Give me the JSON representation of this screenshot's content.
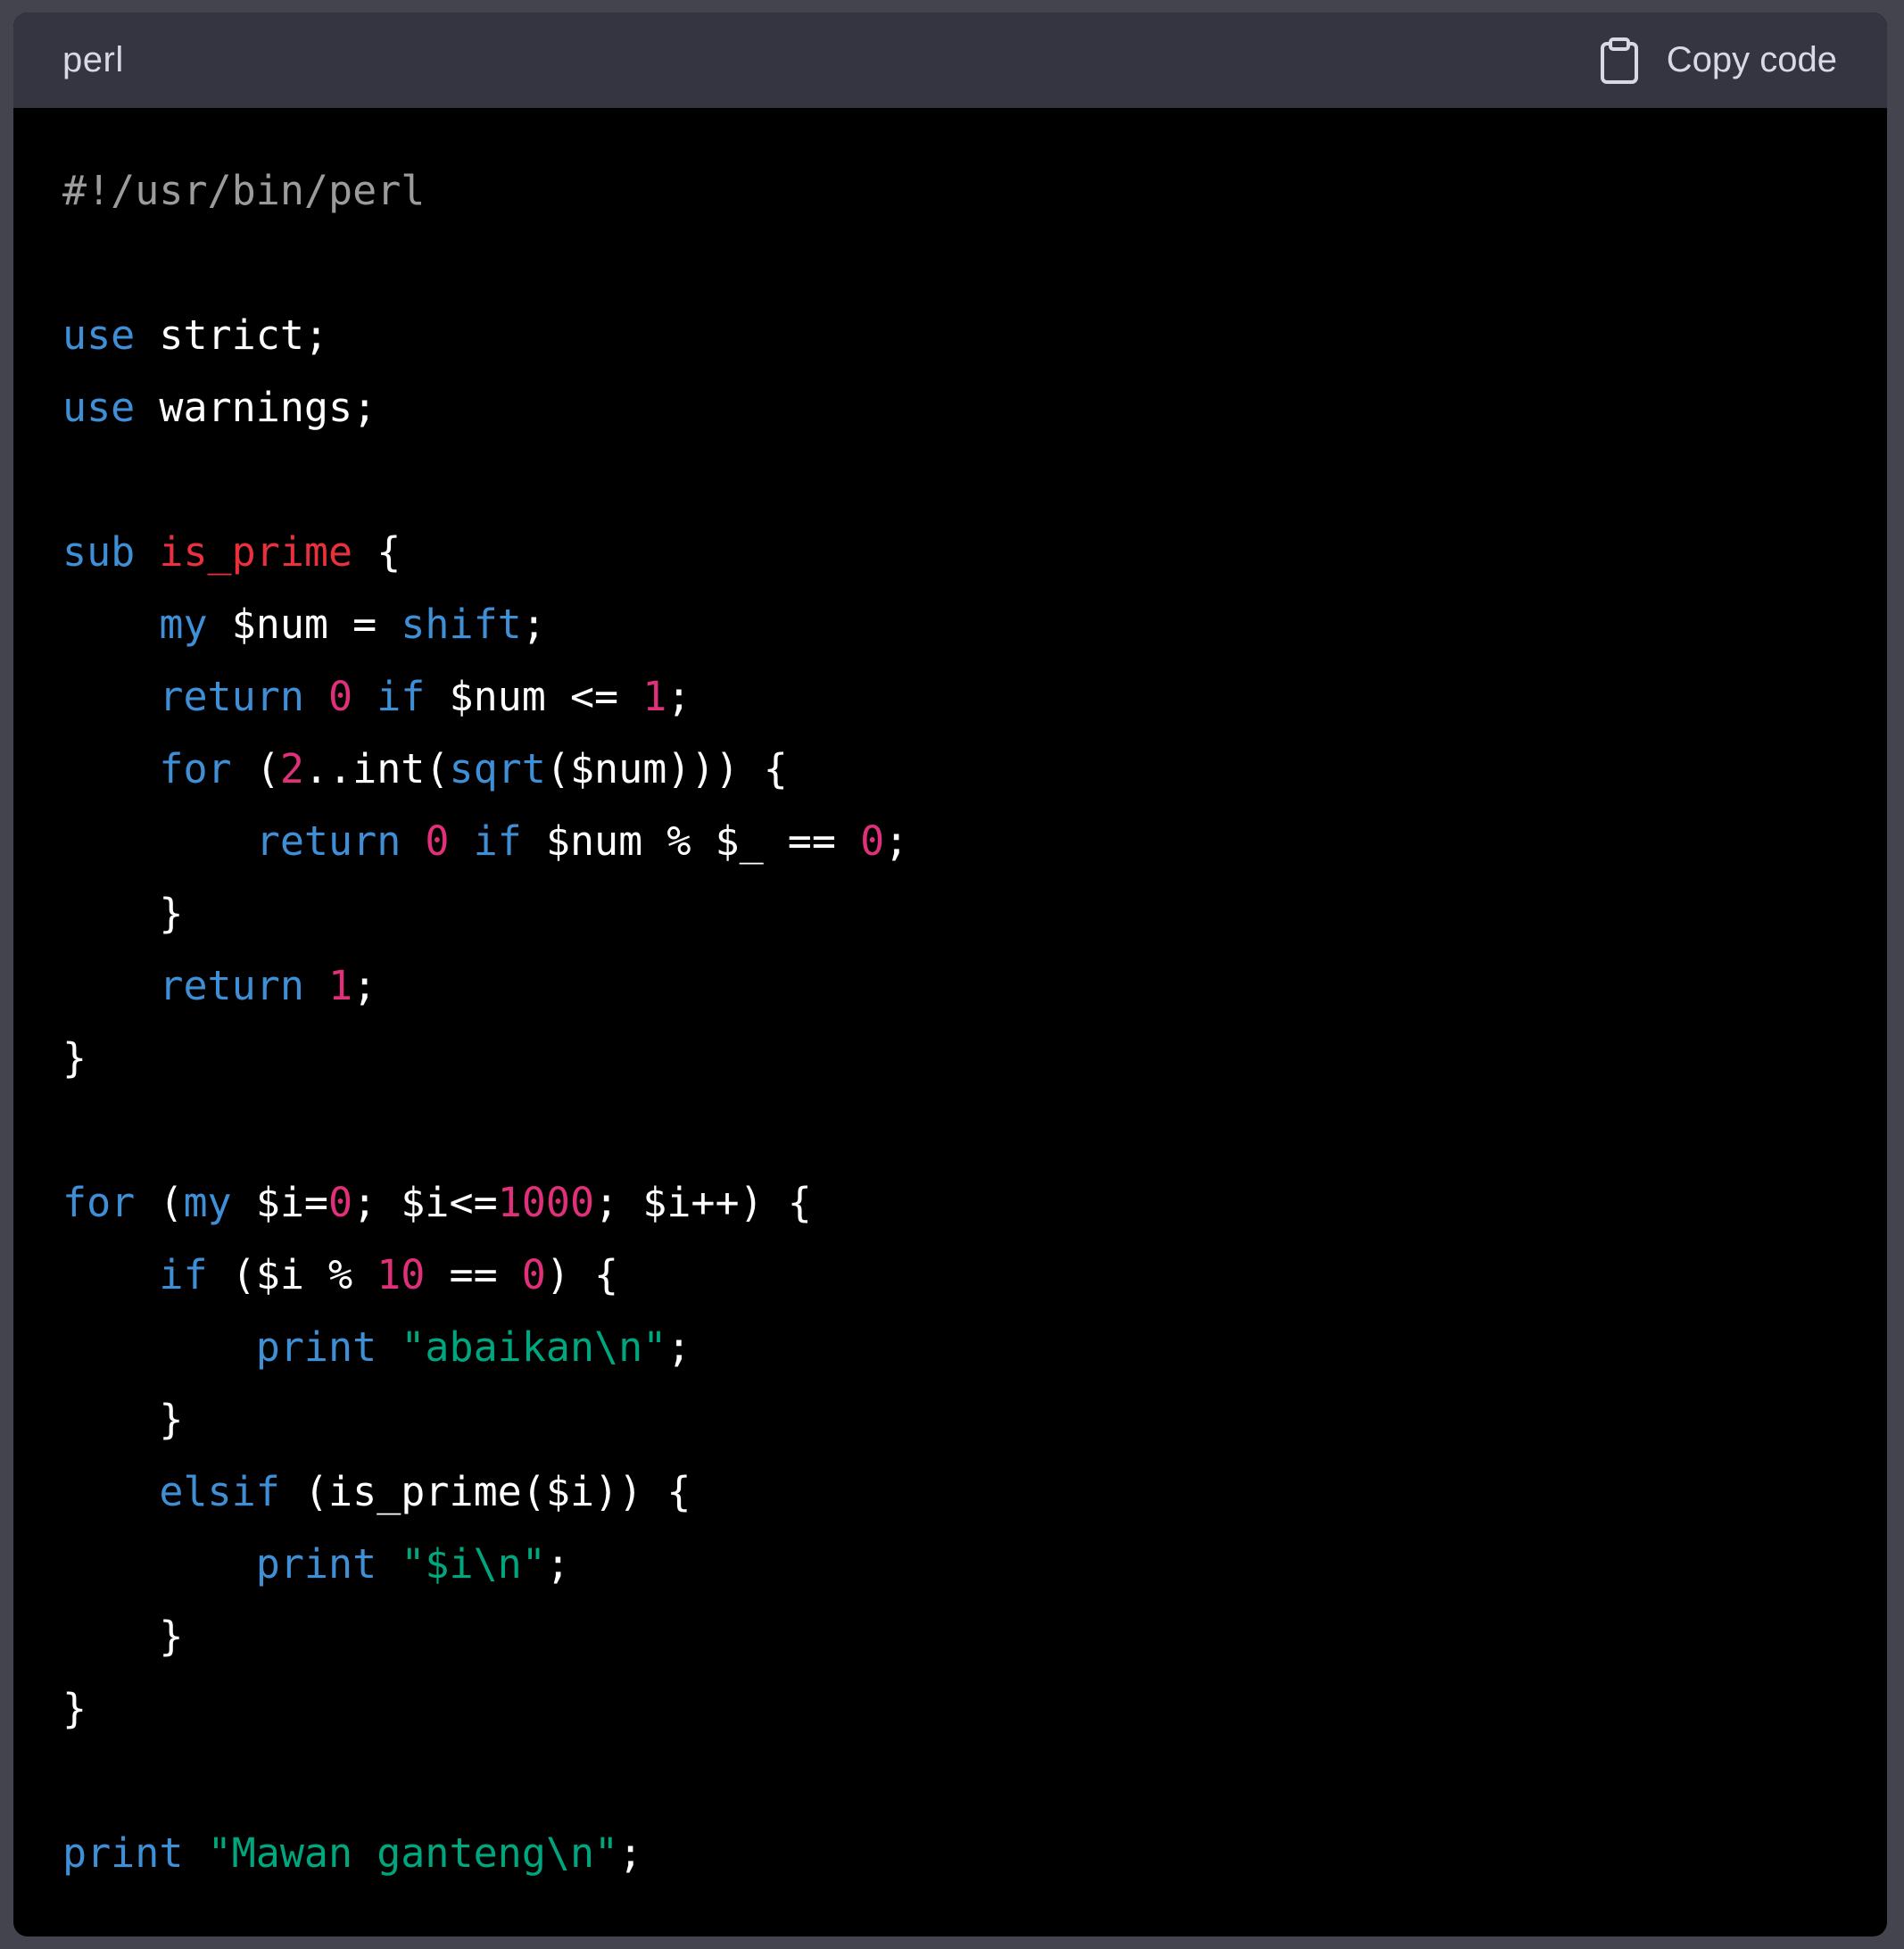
{
  "header": {
    "language": "perl",
    "copy_label": "Copy code",
    "copy_icon": "clipboard-icon"
  },
  "colors": {
    "header_bg": "#343541",
    "code_bg": "#000000",
    "keyword": "#3f8fd6",
    "function_name": "#e9313d",
    "number": "#df3079",
    "string": "#00a67d",
    "comment": "#9b9b9b",
    "plain": "#ffffff"
  },
  "code_lines": [
    [
      {
        "t": "comment",
        "v": "#!/usr/bin/perl"
      }
    ],
    [],
    [
      {
        "t": "keyword",
        "v": "use"
      },
      {
        "t": "plain",
        "v": " strict;"
      }
    ],
    [
      {
        "t": "keyword",
        "v": "use"
      },
      {
        "t": "plain",
        "v": " warnings;"
      }
    ],
    [],
    [
      {
        "t": "keyword",
        "v": "sub"
      },
      {
        "t": "plain",
        "v": " "
      },
      {
        "t": "func",
        "v": "is_prime"
      },
      {
        "t": "plain",
        "v": " {"
      }
    ],
    [
      {
        "t": "plain",
        "v": "    "
      },
      {
        "t": "keyword",
        "v": "my"
      },
      {
        "t": "plain",
        "v": " $num = "
      },
      {
        "t": "keyword",
        "v": "shift"
      },
      {
        "t": "plain",
        "v": ";"
      }
    ],
    [
      {
        "t": "plain",
        "v": "    "
      },
      {
        "t": "keyword",
        "v": "return"
      },
      {
        "t": "plain",
        "v": " "
      },
      {
        "t": "number",
        "v": "0"
      },
      {
        "t": "plain",
        "v": " "
      },
      {
        "t": "keyword",
        "v": "if"
      },
      {
        "t": "plain",
        "v": " $num <= "
      },
      {
        "t": "number",
        "v": "1"
      },
      {
        "t": "plain",
        "v": ";"
      }
    ],
    [
      {
        "t": "plain",
        "v": "    "
      },
      {
        "t": "keyword",
        "v": "for"
      },
      {
        "t": "plain",
        "v": " ("
      },
      {
        "t": "number",
        "v": "2"
      },
      {
        "t": "plain",
        "v": "..int("
      },
      {
        "t": "keyword",
        "v": "sqrt"
      },
      {
        "t": "plain",
        "v": "($num))) {"
      }
    ],
    [
      {
        "t": "plain",
        "v": "        "
      },
      {
        "t": "keyword",
        "v": "return"
      },
      {
        "t": "plain",
        "v": " "
      },
      {
        "t": "number",
        "v": "0"
      },
      {
        "t": "plain",
        "v": " "
      },
      {
        "t": "keyword",
        "v": "if"
      },
      {
        "t": "plain",
        "v": " $num % $_ == "
      },
      {
        "t": "number",
        "v": "0"
      },
      {
        "t": "plain",
        "v": ";"
      }
    ],
    [
      {
        "t": "plain",
        "v": "    }"
      }
    ],
    [
      {
        "t": "plain",
        "v": "    "
      },
      {
        "t": "keyword",
        "v": "return"
      },
      {
        "t": "plain",
        "v": " "
      },
      {
        "t": "number",
        "v": "1"
      },
      {
        "t": "plain",
        "v": ";"
      }
    ],
    [
      {
        "t": "plain",
        "v": "}"
      }
    ],
    [],
    [
      {
        "t": "keyword",
        "v": "for"
      },
      {
        "t": "plain",
        "v": " ("
      },
      {
        "t": "keyword",
        "v": "my"
      },
      {
        "t": "plain",
        "v": " $i="
      },
      {
        "t": "number",
        "v": "0"
      },
      {
        "t": "plain",
        "v": "; $i<="
      },
      {
        "t": "number",
        "v": "1000"
      },
      {
        "t": "plain",
        "v": "; $i++) {"
      }
    ],
    [
      {
        "t": "plain",
        "v": "    "
      },
      {
        "t": "keyword",
        "v": "if"
      },
      {
        "t": "plain",
        "v": " ($i % "
      },
      {
        "t": "number",
        "v": "10"
      },
      {
        "t": "plain",
        "v": " == "
      },
      {
        "t": "number",
        "v": "0"
      },
      {
        "t": "plain",
        "v": ") {"
      }
    ],
    [
      {
        "t": "plain",
        "v": "        "
      },
      {
        "t": "keyword",
        "v": "print"
      },
      {
        "t": "plain",
        "v": " "
      },
      {
        "t": "string",
        "v": "\"abaikan\\n\""
      },
      {
        "t": "plain",
        "v": ";"
      }
    ],
    [
      {
        "t": "plain",
        "v": "    }"
      }
    ],
    [
      {
        "t": "plain",
        "v": "    "
      },
      {
        "t": "keyword",
        "v": "elsif"
      },
      {
        "t": "plain",
        "v": " (is_prime($i)) {"
      }
    ],
    [
      {
        "t": "plain",
        "v": "        "
      },
      {
        "t": "keyword",
        "v": "print"
      },
      {
        "t": "plain",
        "v": " "
      },
      {
        "t": "string",
        "v": "\"$i\\n\""
      },
      {
        "t": "plain",
        "v": ";"
      }
    ],
    [
      {
        "t": "plain",
        "v": "    }"
      }
    ],
    [
      {
        "t": "plain",
        "v": "}"
      }
    ],
    [],
    [
      {
        "t": "keyword",
        "v": "print"
      },
      {
        "t": "plain",
        "v": " "
      },
      {
        "t": "string",
        "v": "\"Mawan ganteng\\n\""
      },
      {
        "t": "plain",
        "v": ";"
      }
    ]
  ]
}
